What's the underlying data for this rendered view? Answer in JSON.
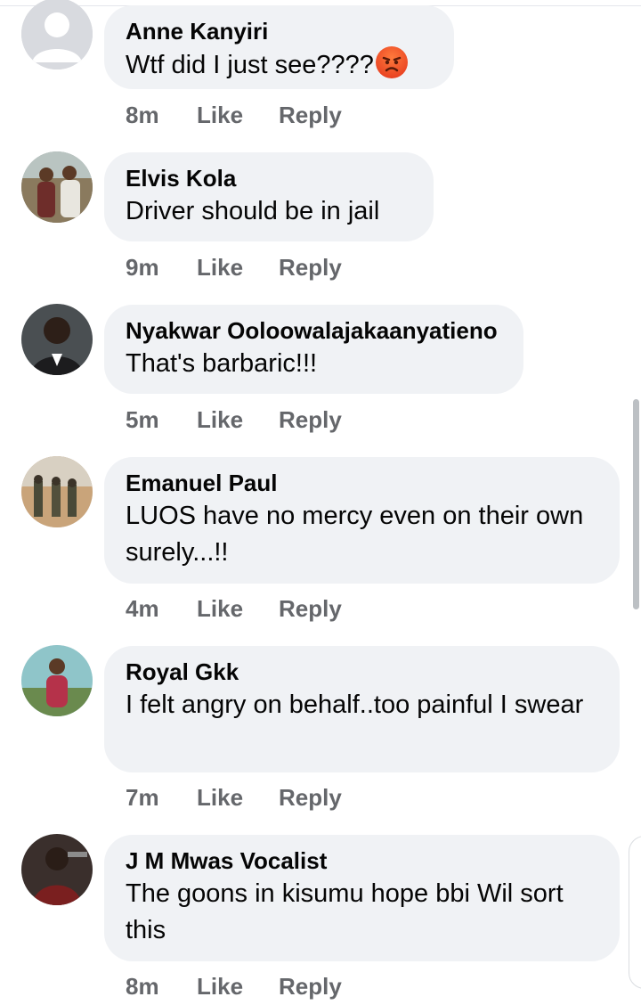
{
  "comments": [
    {
      "name": "Anne Kanyiri",
      "text": "Wtf did I just see????",
      "time": "8m",
      "like": "Like",
      "reply": "Reply",
      "emoji": "angry-face"
    },
    {
      "name": "Elvis Kola",
      "text": "Driver should be in jail",
      "time": "9m",
      "like": "Like",
      "reply": "Reply"
    },
    {
      "name": "Nyakwar Ooloowalajakaanyatieno",
      "text": "That's barbaric!!!",
      "time": "5m",
      "like": "Like",
      "reply": "Reply"
    },
    {
      "name": "Emanuel Paul",
      "text": "LUOS have no mercy even on their own surely...!!",
      "time": "4m",
      "like": "Like",
      "reply": "Reply"
    },
    {
      "name": "Royal Gkk",
      "text": "I felt angry on behalf..too painful I swear",
      "time": "7m",
      "like": "Like",
      "reply": "Reply"
    },
    {
      "name": "J M Mwas Vocalist",
      "text": "The goons in kisumu hope bbi Wil sort this",
      "time": "8m",
      "like": "Like",
      "reply": "Reply"
    }
  ],
  "colors": {
    "bubble": "#f0f2f5",
    "meta_text": "#65676b",
    "name_text": "#050505"
  }
}
